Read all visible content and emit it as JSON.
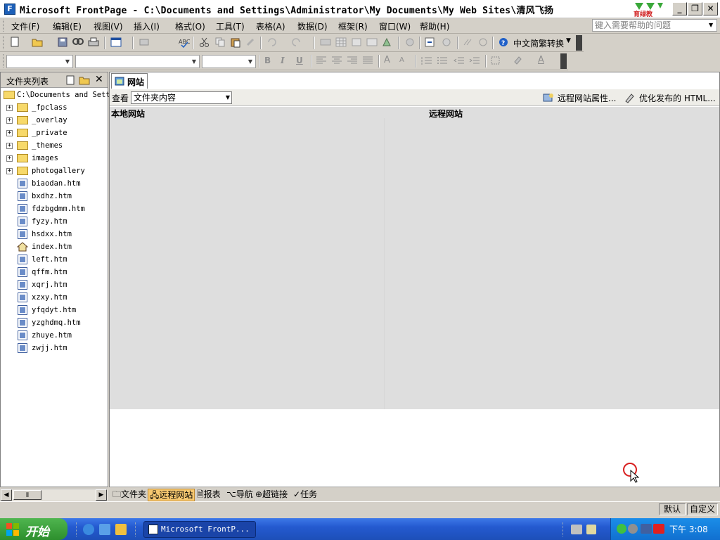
{
  "window": {
    "title": "Microsoft FrontPage - C:\\Documents and Settings\\Administrator\\My Documents\\My Web Sites\\清风飞扬",
    "logo_text": "育绿教"
  },
  "menu": {
    "items": [
      "文件(F)",
      "编辑(E)",
      "视图(V)",
      "插入(I)",
      "格式(O)",
      "工具(T)",
      "表格(A)",
      "数据(D)",
      "框架(R)",
      "窗口(W)",
      "帮助(H)"
    ],
    "help_placeholder": "键入需要帮助的问题"
  },
  "toolbar": {
    "convert_label": "中文简繁转换"
  },
  "folder_list": {
    "title": "文件夹列表",
    "root": "C:\\Documents and Sett",
    "folders": [
      "_fpclass",
      "_overlay",
      "_private",
      "_themes",
      "images",
      "photogallery"
    ],
    "files": [
      "biaodan.htm",
      "bxdhz.htm",
      "fdzbgdmm.htm",
      "fyzy.htm",
      "hsdxx.htm",
      "index.htm",
      "left.htm",
      "qffm.htm",
      "xqrj.htm",
      "xzxy.htm",
      "yfqdyt.htm",
      "yzghdmq.htm",
      "zhuye.htm",
      "zwjj.htm"
    ]
  },
  "document": {
    "tab_label": "网站",
    "view_label": "查看",
    "view_value": "文件夹内容",
    "remote_props": "远程网站属性...",
    "optimize_publish": "优化发布的 HTML...",
    "local_site": "本地网站",
    "remote_site": "远程网站"
  },
  "view_tabs": [
    {
      "label": "文件夹",
      "active": false
    },
    {
      "label": "远程网站",
      "active": true
    },
    {
      "label": "报表",
      "active": false
    },
    {
      "label": "导航",
      "active": false
    },
    {
      "label": "超链接",
      "active": false
    },
    {
      "label": "任务",
      "active": false
    }
  ],
  "status": {
    "mode": "默认",
    "custom": "自定义"
  },
  "taskbar": {
    "start_label": "开始",
    "app_button": "Microsoft FrontP...",
    "clock": "下午 3:08"
  },
  "colors": {
    "taskbar_blue": "#245ad0",
    "start_green": "#2d8f2d",
    "active_tab": "#f7c870",
    "panel_gray": "#dedede"
  }
}
